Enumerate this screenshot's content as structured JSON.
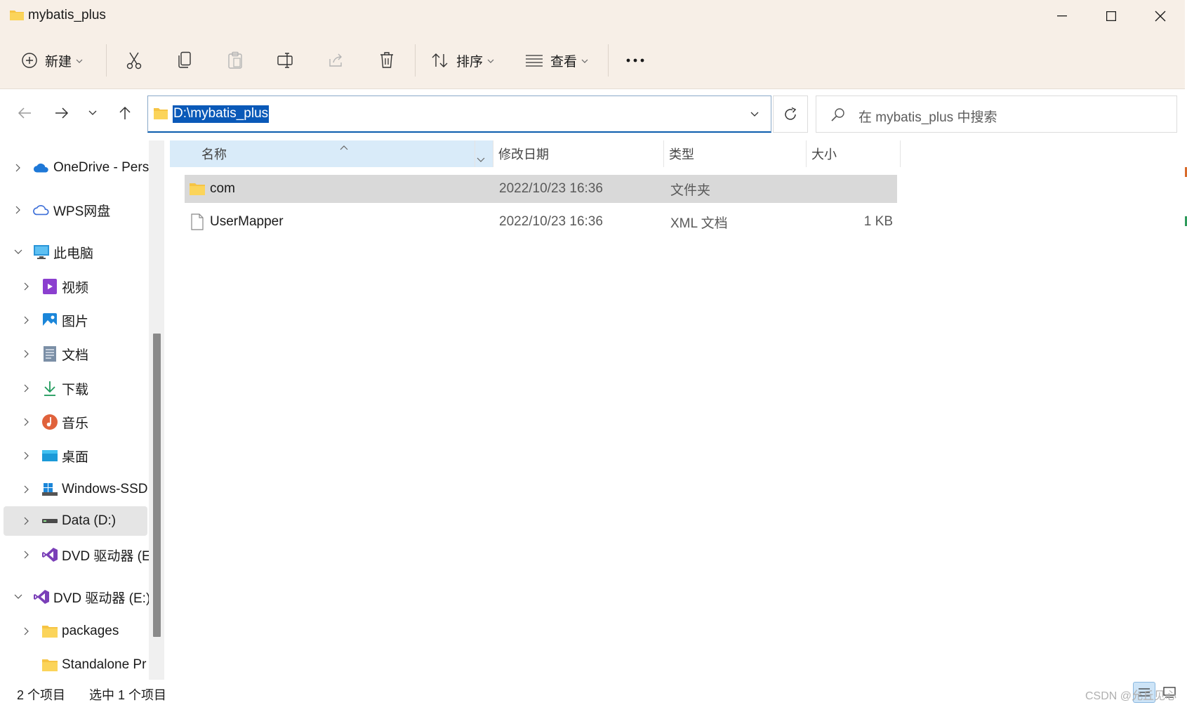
{
  "window": {
    "title": "mybatis_plus"
  },
  "commands": {
    "new_label": "新建",
    "sort_label": "排序",
    "view_label": "查看"
  },
  "address": {
    "path": "D:\\mybatis_plus",
    "search_placeholder": "在 mybatis_plus 中搜索"
  },
  "sidebar": {
    "items": [
      {
        "label": "OneDrive - Pers",
        "icon": "onedrive-cloud-icon"
      },
      {
        "label": "WPS网盘",
        "icon": "wps-cloud-icon"
      },
      {
        "label": "此电脑",
        "icon": "computer-icon"
      },
      {
        "label": "视频",
        "icon": "video-icon"
      },
      {
        "label": "图片",
        "icon": "pictures-icon"
      },
      {
        "label": "文档",
        "icon": "documents-icon"
      },
      {
        "label": "下载",
        "icon": "download-icon"
      },
      {
        "label": "音乐",
        "icon": "music-icon"
      },
      {
        "label": "桌面",
        "icon": "desktop-icon"
      },
      {
        "label": "Windows-SSD",
        "icon": "windows-drive-icon"
      },
      {
        "label": "Data (D:)",
        "icon": "drive-icon"
      },
      {
        "label": "DVD 驱动器 (E:",
        "icon": "visual-studio-icon"
      },
      {
        "label": "DVD 驱动器 (E:)",
        "icon": "visual-studio-icon"
      },
      {
        "label": "packages",
        "icon": "folder-icon"
      },
      {
        "label": "Standalone Pr",
        "icon": "folder-icon"
      }
    ]
  },
  "columns": {
    "name": "名称",
    "modified": "修改日期",
    "type": "类型",
    "size": "大小"
  },
  "files": [
    {
      "name": "com",
      "modified": "2022/10/23 16:36",
      "type": "文件夹",
      "size": "",
      "icon": "folder-icon"
    },
    {
      "name": "UserMapper",
      "modified": "2022/10/23 16:36",
      "type": "XML 文档",
      "size": "1 KB",
      "icon": "file-icon"
    }
  ],
  "status": {
    "item_count": "2 个项目",
    "selected_count": "选中 1 个项目",
    "watermark": "CSDN @允丘见心"
  },
  "colors": {
    "accent": "#0a59b8",
    "titlebar_bg": "#f7efe7",
    "folder_yellow": "#f6c444",
    "selection_gray": "#d9d9d9",
    "sort_header_bg": "#d9ebf9"
  }
}
